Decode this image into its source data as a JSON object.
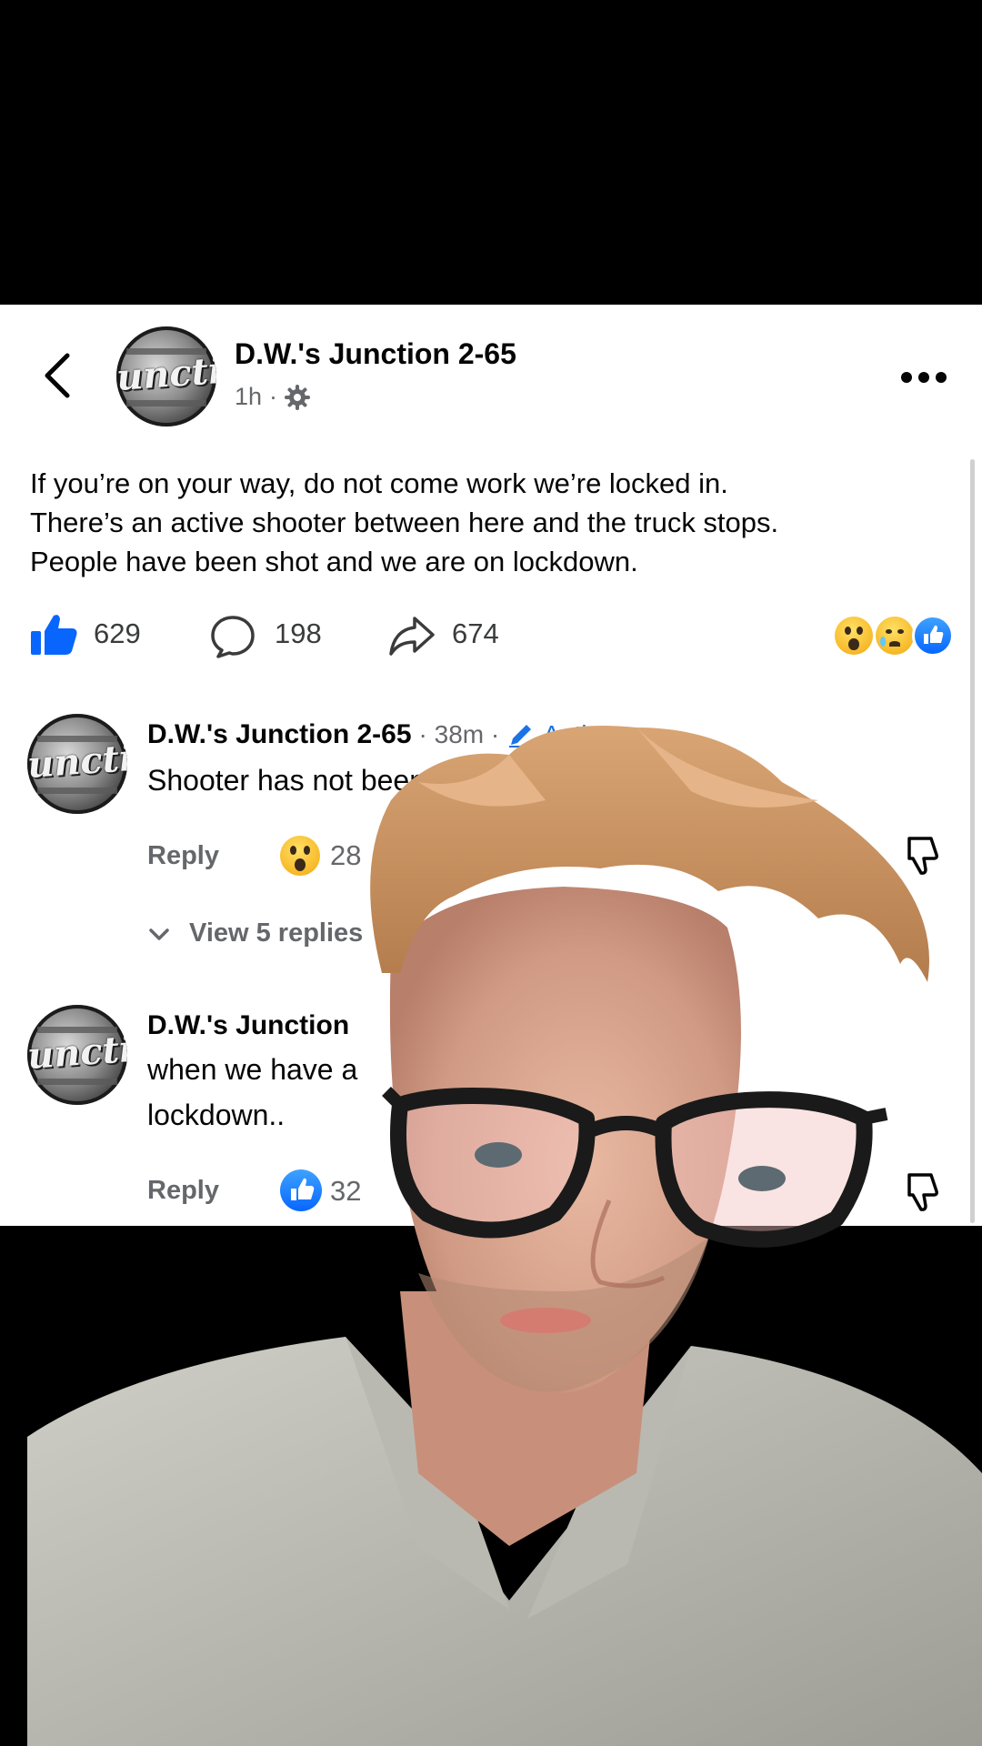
{
  "post": {
    "page_name": "D.W.'s Junction 2-65",
    "time": "1h",
    "separator": "·",
    "text_lines": [
      "If you’re on your way, do not come work we’re locked in.",
      "There’s an active shooter between here and the truck stops.",
      "People have been shot and we are on lockdown."
    ],
    "likes": "629",
    "comments": "198",
    "shares": "674",
    "avatar_text": "unctic"
  },
  "comments": [
    {
      "name": "D.W.'s Junction 2-65",
      "meta": "· 38m ·",
      "author_label": "Author",
      "text": "Shooter has not been stopped",
      "reply_label": "Reply",
      "reaction_count": "28",
      "reaction": "wow-emoji",
      "view_replies": "View 5 replies"
    },
    {
      "name": "D.W.'s Junction",
      "text_line1": "when we have a",
      "text_line2": "lockdown..",
      "reply_label": "Reply",
      "reaction_count": "32",
      "reaction": "like-emoji"
    }
  ],
  "colors": {
    "like_blue": "#0866ff",
    "author_blue": "#1b74e4",
    "meta_gray": "#65676b",
    "background_black": "#000000"
  }
}
